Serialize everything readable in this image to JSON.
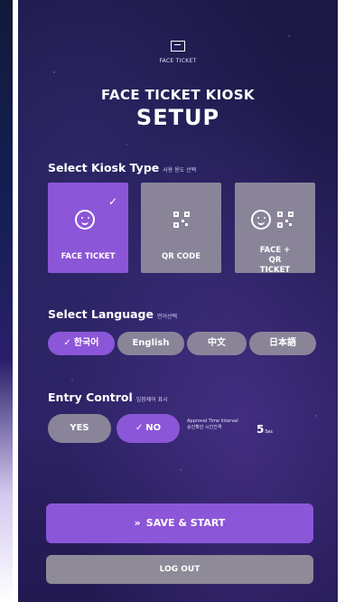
{
  "header": {
    "logo_text": "FACE TICKET",
    "title": "FACE TICKET KIOSK",
    "subtitle": "SETUP"
  },
  "kiosk_type": {
    "label": "Select Kiosk Type",
    "sub_label": "사용 용도 선택",
    "options": [
      {
        "label": "FACE TICKET",
        "icon": "face-icon",
        "selected": true
      },
      {
        "label": "QR CODE",
        "icon": "qr-code-icon",
        "selected": false
      },
      {
        "label": "FACE + QR TICKET",
        "icon": "face-qr-icon",
        "selected": false
      }
    ]
  },
  "language": {
    "label": "Select Language",
    "sub_label": "언어선택",
    "options": [
      {
        "label": "한국어",
        "selected": true
      },
      {
        "label": "English",
        "selected": false
      },
      {
        "label": "中文",
        "selected": false
      },
      {
        "label": "日本語",
        "selected": false
      }
    ]
  },
  "entry_control": {
    "label": "Entry Control",
    "sub_label": "입장제어 표시",
    "options": [
      {
        "label": "YES",
        "selected": false
      },
      {
        "label": "NO",
        "selected": true
      }
    ],
    "interval_label_en": "Approval Time Interval",
    "interval_label_ko": "승인확인 시간간격",
    "interval_value": "5",
    "interval_unit": "Sec"
  },
  "actions": {
    "save_label": "SAVE & START",
    "logout_label": "LOG OUT"
  },
  "colors": {
    "accent": "#8c56d8",
    "inactive": "#8a8499",
    "background": "#211c52"
  }
}
